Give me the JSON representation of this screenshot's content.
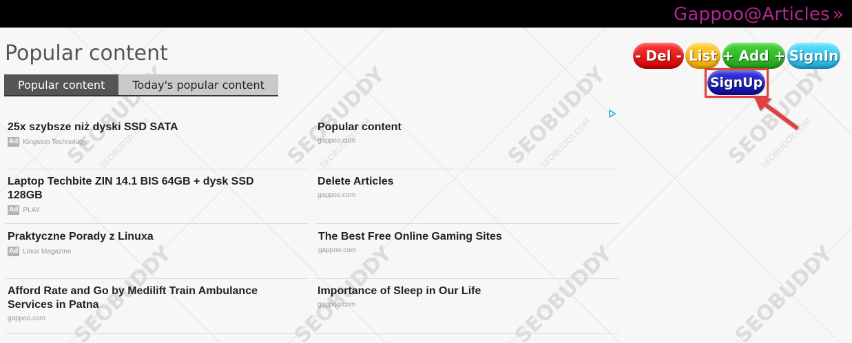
{
  "header": {
    "brand": "Gappoo@Articles",
    "brand_chevron": "»"
  },
  "page": {
    "title": "Popular content"
  },
  "tabs": [
    {
      "label": "Popular content",
      "active": true
    },
    {
      "label": "Today's popular content",
      "active": false
    }
  ],
  "buttons": {
    "del": "- Del -",
    "list": "List",
    "add": "+ Add +",
    "signin": "SignIn",
    "signup": "SignUp"
  },
  "items": [
    {
      "title": "25x szybsze niż dyski SSD SATA",
      "ad": "Ad",
      "source": "Kingston Technology"
    },
    {
      "title": "Popular content",
      "source": "gappoo.com"
    },
    {
      "title": "Laptop Techbite ZIN 14.1 BIS 64GB + dysk SSD 128GB",
      "ad": "Ad",
      "source": "PLAY"
    },
    {
      "title": "Delete Articles",
      "source": "gappoo.com"
    },
    {
      "title": "Praktyczne Porady z Linuxa",
      "ad": "Ad",
      "source": "Linux Magazine"
    },
    {
      "title": "The Best Free Online Gaming Sites",
      "source": "gappoo.com"
    },
    {
      "title": "Afford Rate and Go by Medilift Train Ambulance Services in Patna",
      "source": "gappoo.com"
    },
    {
      "title": "Importance of Sleep in Our Life",
      "source": "gappoo.com"
    }
  ],
  "watermark": {
    "text": "SEOBUDDY",
    "subtext": "SEOBUDDY.COM"
  },
  "colors": {
    "brand": "#b5268f",
    "highlight": "#e0413f"
  }
}
